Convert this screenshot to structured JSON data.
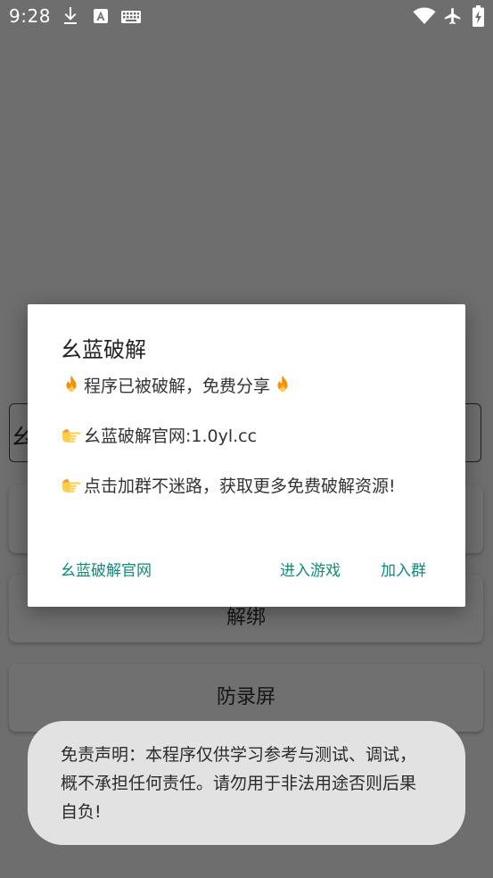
{
  "status_bar": {
    "time": "9:28",
    "left_icons": [
      "download-icon",
      "text-a-icon",
      "keyboard-icon"
    ],
    "right_icons": [
      "wifi-icon",
      "airplane-icon",
      "battery-charging-icon"
    ]
  },
  "background_app": {
    "partial_field_text": "幺",
    "button_partial_label": "解绑",
    "button_label": "防录屏"
  },
  "dialog": {
    "title": "幺蓝破解",
    "line1": "程序已被破解，免费分享",
    "line2": "幺蓝破解官网:1.0yl.cc",
    "line3": "点击加群不迷路，获取更多免费破解资源!",
    "buttons": {
      "neutral": "幺蓝破解官网",
      "negative": "进入游戏",
      "positive": "加入群"
    },
    "accent_color": "#128a7a"
  },
  "toast": {
    "text": "免责声明：本程序仅供学习参考与测试、调试，概不承担任何责任。请勿用于非法用途否则后果自负!"
  }
}
